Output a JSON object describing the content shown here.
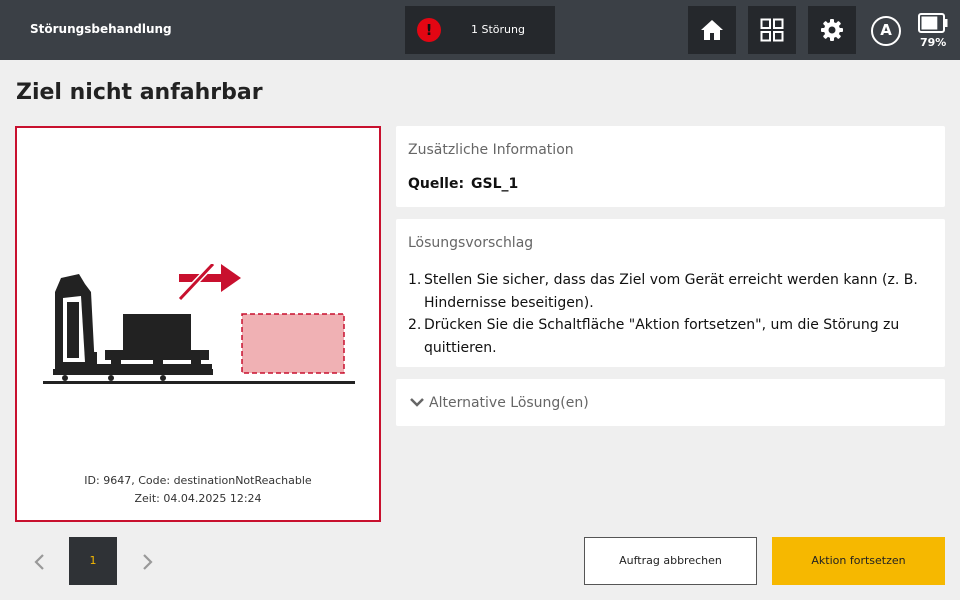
{
  "header": {
    "app_title": "Störungsbehandlung",
    "alert_label": "1 Störung",
    "alert_icon_glyph": "!",
    "mode_glyph": "A",
    "battery_percent": "79%",
    "battery_level": 0.79,
    "icons": [
      "home-icon",
      "grid-icon",
      "gear-icon",
      "auto-mode-icon",
      "battery-icon"
    ]
  },
  "page": {
    "title": "Ziel nicht anfahrbar"
  },
  "illustration": {
    "id_code": "ID: 9647, Code: destinationNotReachable",
    "time": "Zeit: 04.04.2025 12:24",
    "accent_color": "#c8102e"
  },
  "info_card": {
    "title": "Zusätzliche Information",
    "source_label": "Quelle:",
    "source_value": "GSL_1"
  },
  "solution_card": {
    "title": "Lösungsvorschlag",
    "steps": [
      {
        "num": "1.",
        "text": "Stellen Sie sicher, dass das Ziel vom Gerät erreicht werden kann (z. B. Hindernisse beseitigen)."
      },
      {
        "num": "2.",
        "text": "Drücken Sie die Schaltfläche \"Aktion fortsetzen\", um die Störung zu quittieren."
      }
    ]
  },
  "alt_card": {
    "label": "Alternative Lösung(en)"
  },
  "pagination": {
    "current": "1"
  },
  "actions": {
    "cancel_label": "Auftrag abbrechen",
    "continue_label": "Aktion fortsetzen",
    "continue_color": "#f6b800"
  }
}
